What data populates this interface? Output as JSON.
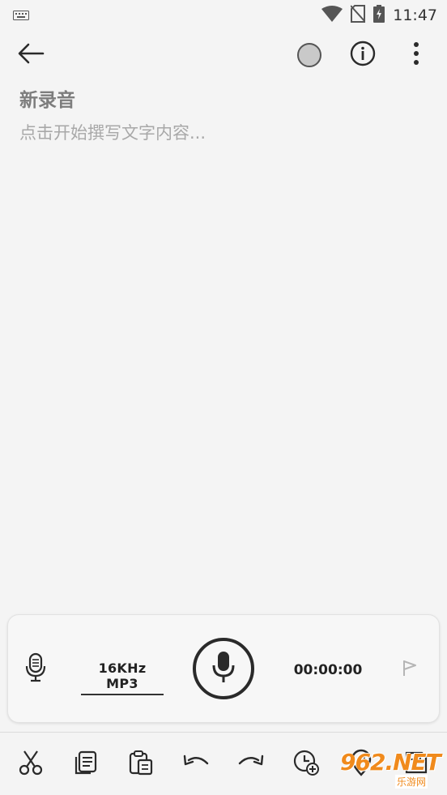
{
  "status_bar": {
    "time": "11:47",
    "icons": [
      "keyboard-icon",
      "wifi-icon",
      "no-sim-icon",
      "battery-charging-icon"
    ]
  },
  "app_bar": {
    "icons": [
      "back-arrow-icon",
      "color-circle-icon",
      "info-icon",
      "more-vert-icon"
    ],
    "color_dot": "#c9c9c9"
  },
  "note": {
    "title": "新录音",
    "body_placeholder": "点击开始撰写文字内容..."
  },
  "recorder": {
    "format": "16KHz MP3",
    "timer": "00:00:00",
    "icons": [
      "microphone-icon",
      "record-mic-icon",
      "flag-icon"
    ]
  },
  "toolbar": {
    "icons": [
      "cut-icon",
      "copy-icon",
      "paste-icon",
      "undo-icon",
      "redo-icon",
      "add-timestamp-icon",
      "location-icon",
      "save-icon"
    ]
  },
  "watermark": {
    "main": "962.NET",
    "sub": "乐游网"
  },
  "colors": {
    "background": "#f4f4f4",
    "icon": "#2a2a2a",
    "watermark": "#f08a1c"
  }
}
